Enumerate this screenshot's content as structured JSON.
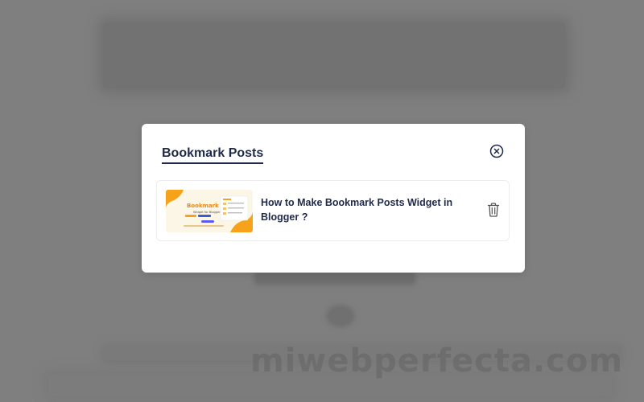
{
  "modal": {
    "title": "Bookmark Posts",
    "close_icon": "close-circle-icon"
  },
  "bookmarks": [
    {
      "title": "How to Make Bookmark Posts Widget in Blogger ?",
      "thumbnail": {
        "headline": "Bookmark Posts",
        "subheadline": "Widget for Blogger"
      },
      "delete_icon": "trash-icon"
    }
  ],
  "watermark": "miwebperfecta.com",
  "colors": {
    "overlay": "#7f7f7f",
    "modal_bg": "#ffffff",
    "title_text": "#1f2a4b",
    "thumb_accent": "#f7a21b"
  }
}
